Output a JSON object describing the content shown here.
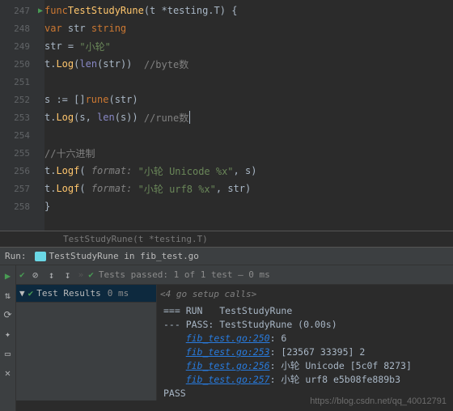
{
  "lines": [
    {
      "num": "247"
    },
    {
      "num": "248"
    },
    {
      "num": "249"
    },
    {
      "num": "250"
    },
    {
      "num": "251"
    },
    {
      "num": "252"
    },
    {
      "num": "253"
    },
    {
      "num": "254"
    },
    {
      "num": "255"
    },
    {
      "num": "256"
    },
    {
      "num": "257"
    },
    {
      "num": "258"
    }
  ],
  "code": {
    "l247": {
      "kw1": "func",
      "fn": "TestStudyRune",
      "p": "(t *",
      "typ": "testing.T",
      "p2": ") {"
    },
    "l248": {
      "kw": "var",
      "id": " str ",
      "typ": "string"
    },
    "l249": {
      "id": "str = ",
      "str": "\"小轮\""
    },
    "l250": {
      "id": "t.",
      "fn": "Log",
      "p": "(",
      "bi": "len",
      "p2": "(str))  ",
      "com": "//byte数"
    },
    "l252": {
      "id": "s := []",
      "typ": "rune",
      "p": "(str)"
    },
    "l253": {
      "id": "t.",
      "fn": "Log",
      "p": "(s, ",
      "bi": "len",
      "p2": "(s)) ",
      "com": "//rune数"
    },
    "l255": {
      "com": "//十六进制"
    },
    "l256": {
      "id": "t.",
      "fn": "Logf",
      "p": "( ",
      "hint": "format:",
      "str": " \"小轮 Unicode %x\"",
      "p2": ", s)"
    },
    "l257": {
      "id": "t.",
      "fn": "Logf",
      "p": "( ",
      "hint": "format:",
      "str": " \"小轮 urf8 %x\"",
      "p2": ", str)"
    },
    "l258": {
      "p": "}"
    }
  },
  "structHint": "TestStudyRune(t *testing.T)",
  "run": {
    "label": "Run:",
    "config": "TestStudyRune in fib_test.go",
    "passedText": "Tests passed: 1",
    "passedTail": " of 1 test – 0 ms",
    "treeRoot": "Test Results",
    "treeTime": "0 ms",
    "setupCalls": "<4 go setup calls>",
    "out": {
      "run": "=== RUN   TestStudyRune",
      "pass": "--- PASS: TestStudyRune (0.00s)",
      "l1_link": "fib_test.go:250",
      "l1_tail": ": 6",
      "l2_link": "fib_test.go:253",
      "l2_tail": ": [23567 33395] 2",
      "l3_link": "fib_test.go:256",
      "l3_tail": ": 小轮 Unicode [5c0f 8273]",
      "l4_link": "fib_test.go:257",
      "l4_tail": ": 小轮 urf8 e5b08fe889b3",
      "passWord": "PASS"
    }
  },
  "watermark": "https://blog.csdn.net/qq_40012791"
}
